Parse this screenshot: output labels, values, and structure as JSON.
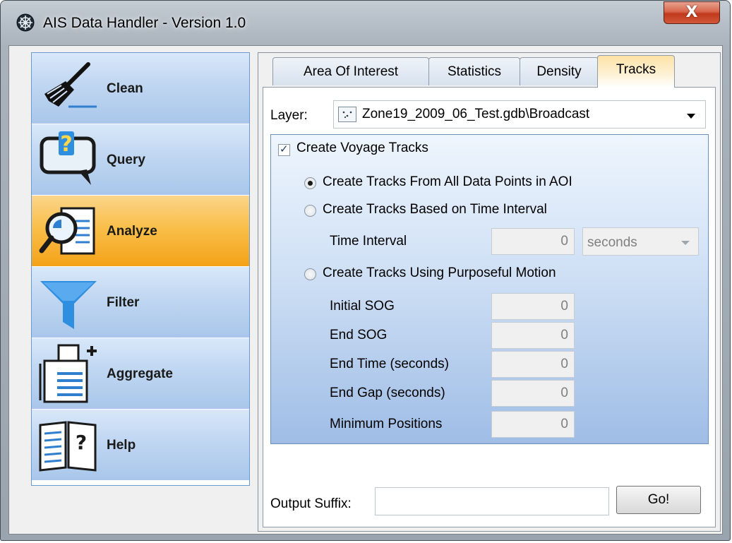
{
  "window": {
    "title": "AIS Data Handler - Version 1.0",
    "close_label": "X"
  },
  "nav": {
    "items": [
      {
        "label": "Clean",
        "icon": "broom-icon"
      },
      {
        "label": "Query",
        "icon": "speech-question-icon"
      },
      {
        "label": "Analyze",
        "icon": "magnifier-document-icon",
        "selected": true
      },
      {
        "label": "Filter",
        "icon": "funnel-icon"
      },
      {
        "label": "Aggregate",
        "icon": "document-add-icon"
      },
      {
        "label": "Help",
        "icon": "book-question-icon"
      }
    ]
  },
  "tabs": [
    "Area Of Interest",
    "Statistics",
    "Density",
    "Tracks"
  ],
  "active_tab": "Tracks",
  "tracks": {
    "layer_label": "Layer:",
    "layer_value": "Zone19_2009_06_Test.gdb\\Broadcast",
    "create_voyage_tracks": {
      "label": "Create Voyage Tracks",
      "checked": true
    },
    "options": {
      "all_points": {
        "label": "Create Tracks From All Data Points in AOI",
        "selected": true
      },
      "time_interval": {
        "label": "Create Tracks Based on Time Interval",
        "selected": false
      },
      "purposeful_motion": {
        "label": "Create Tracks Using Purposeful Motion",
        "selected": false
      }
    },
    "time_interval": {
      "label": "Time Interval",
      "value": "0",
      "unit": "seconds"
    },
    "fields": {
      "initial_sog": {
        "label": "Initial SOG",
        "value": "0"
      },
      "end_sog": {
        "label": "End SOG",
        "value": "0"
      },
      "end_time": {
        "label": "End Time (seconds)",
        "value": "0"
      },
      "end_gap": {
        "label": "End Gap (seconds)",
        "value": "0"
      },
      "min_positions": {
        "label": "Minimum Positions",
        "value": "0"
      }
    },
    "output_suffix_label": "Output Suffix:",
    "output_suffix_value": "",
    "go_label": "Go!"
  },
  "colors": {
    "nav_selected": "#f9bf4a",
    "nav_default": "#c2d8f2",
    "group_bottom": "#9fbde6",
    "active_tab": "#fde2a6"
  }
}
